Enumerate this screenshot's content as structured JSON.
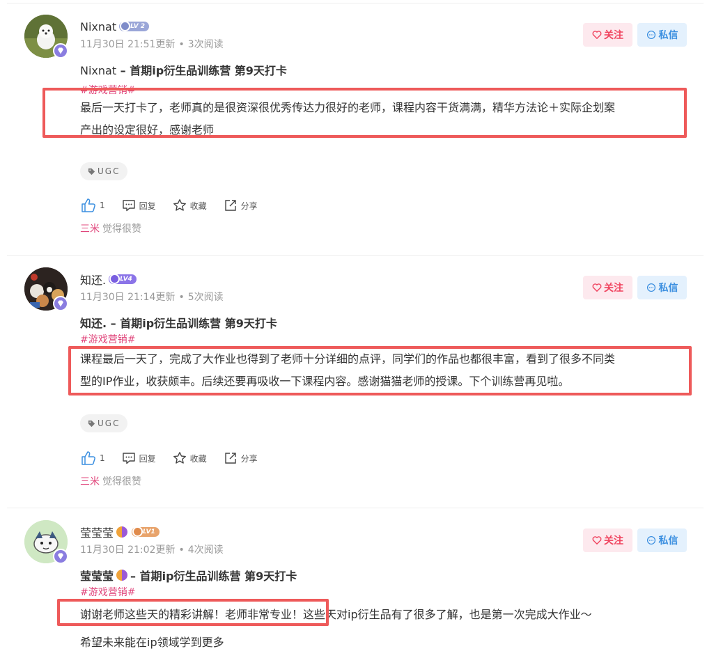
{
  "posts": [
    {
      "username": "Nixnat",
      "level": "LV 2",
      "date": "11月30日 21:51更新",
      "reads": "3次阅读",
      "title_user": "Nixnat",
      "title_rest": " – 首期ip衍生品训练营 第9天打卡",
      "topic": "#游戏营销#",
      "content_lines": [
        "最后一天打卡了，老师真的是很资深很优秀传达力很好的老师，课程内容干货满满，精华方法论＋实际企划案",
        "产出的设定很好，感谢老师"
      ],
      "tag": "UGC",
      "like_count": "1",
      "reply_label": "回复",
      "collect_label": "收藏",
      "share_label": "分享",
      "liker": "三米",
      "liked_text": "觉得很赞",
      "follow_label": "关注",
      "message_label": "私信"
    },
    {
      "username": "知还.",
      "level": "LV4",
      "date": "11月30日 21:14更新",
      "reads": "5次阅读",
      "title_user": "知还.",
      "title_rest": " – 首期ip衍生品训练营 第9天打卡",
      "topic": "#游戏营销#",
      "content_lines": [
        "课程最后一天了，完成了大作业也得到了老师十分详细的点评，同学们的作品也都很丰富，看到了很多不同类",
        "型的IP作业，收获颇丰。后续还要再吸收一下课程内容。感谢猫猫老师的授课。下个训练营再见啦。"
      ],
      "tag": "UGC",
      "like_count": "1",
      "reply_label": "回复",
      "collect_label": "收藏",
      "share_label": "分享",
      "liker": "三米",
      "liked_text": "觉得很赞",
      "follow_label": "关注",
      "message_label": "私信"
    },
    {
      "username": "莹莹莹",
      "level": "LV1",
      "date": "11月30日 21:02更新",
      "reads": "4次阅读",
      "title_user": "莹莹莹",
      "title_rest": " – 首期ip衍生品训练营 第9天打卡",
      "topic": "#游戏营销#",
      "content_lines": [
        "谢谢老师这些天的精彩讲解！老师非常专业！这些天对ip衍生品有了很多了解，也是第一次完成大作业〜",
        "希望未来能在ip领域学到更多"
      ],
      "follow_label": "关注",
      "message_label": "私信"
    }
  ],
  "colors": {
    "accent_pink": "#e0457b",
    "follow_red": "#f0445f",
    "message_blue": "#3b8fe0",
    "highlight_red": "#ee5a5a",
    "meta_gray": "#999999"
  },
  "icons": [
    "heart-icon",
    "chat-bubble-icon",
    "thumbs-up-icon",
    "comment-icon",
    "star-icon",
    "share-icon",
    "tag-icon",
    "diamond-badge-icon"
  ]
}
